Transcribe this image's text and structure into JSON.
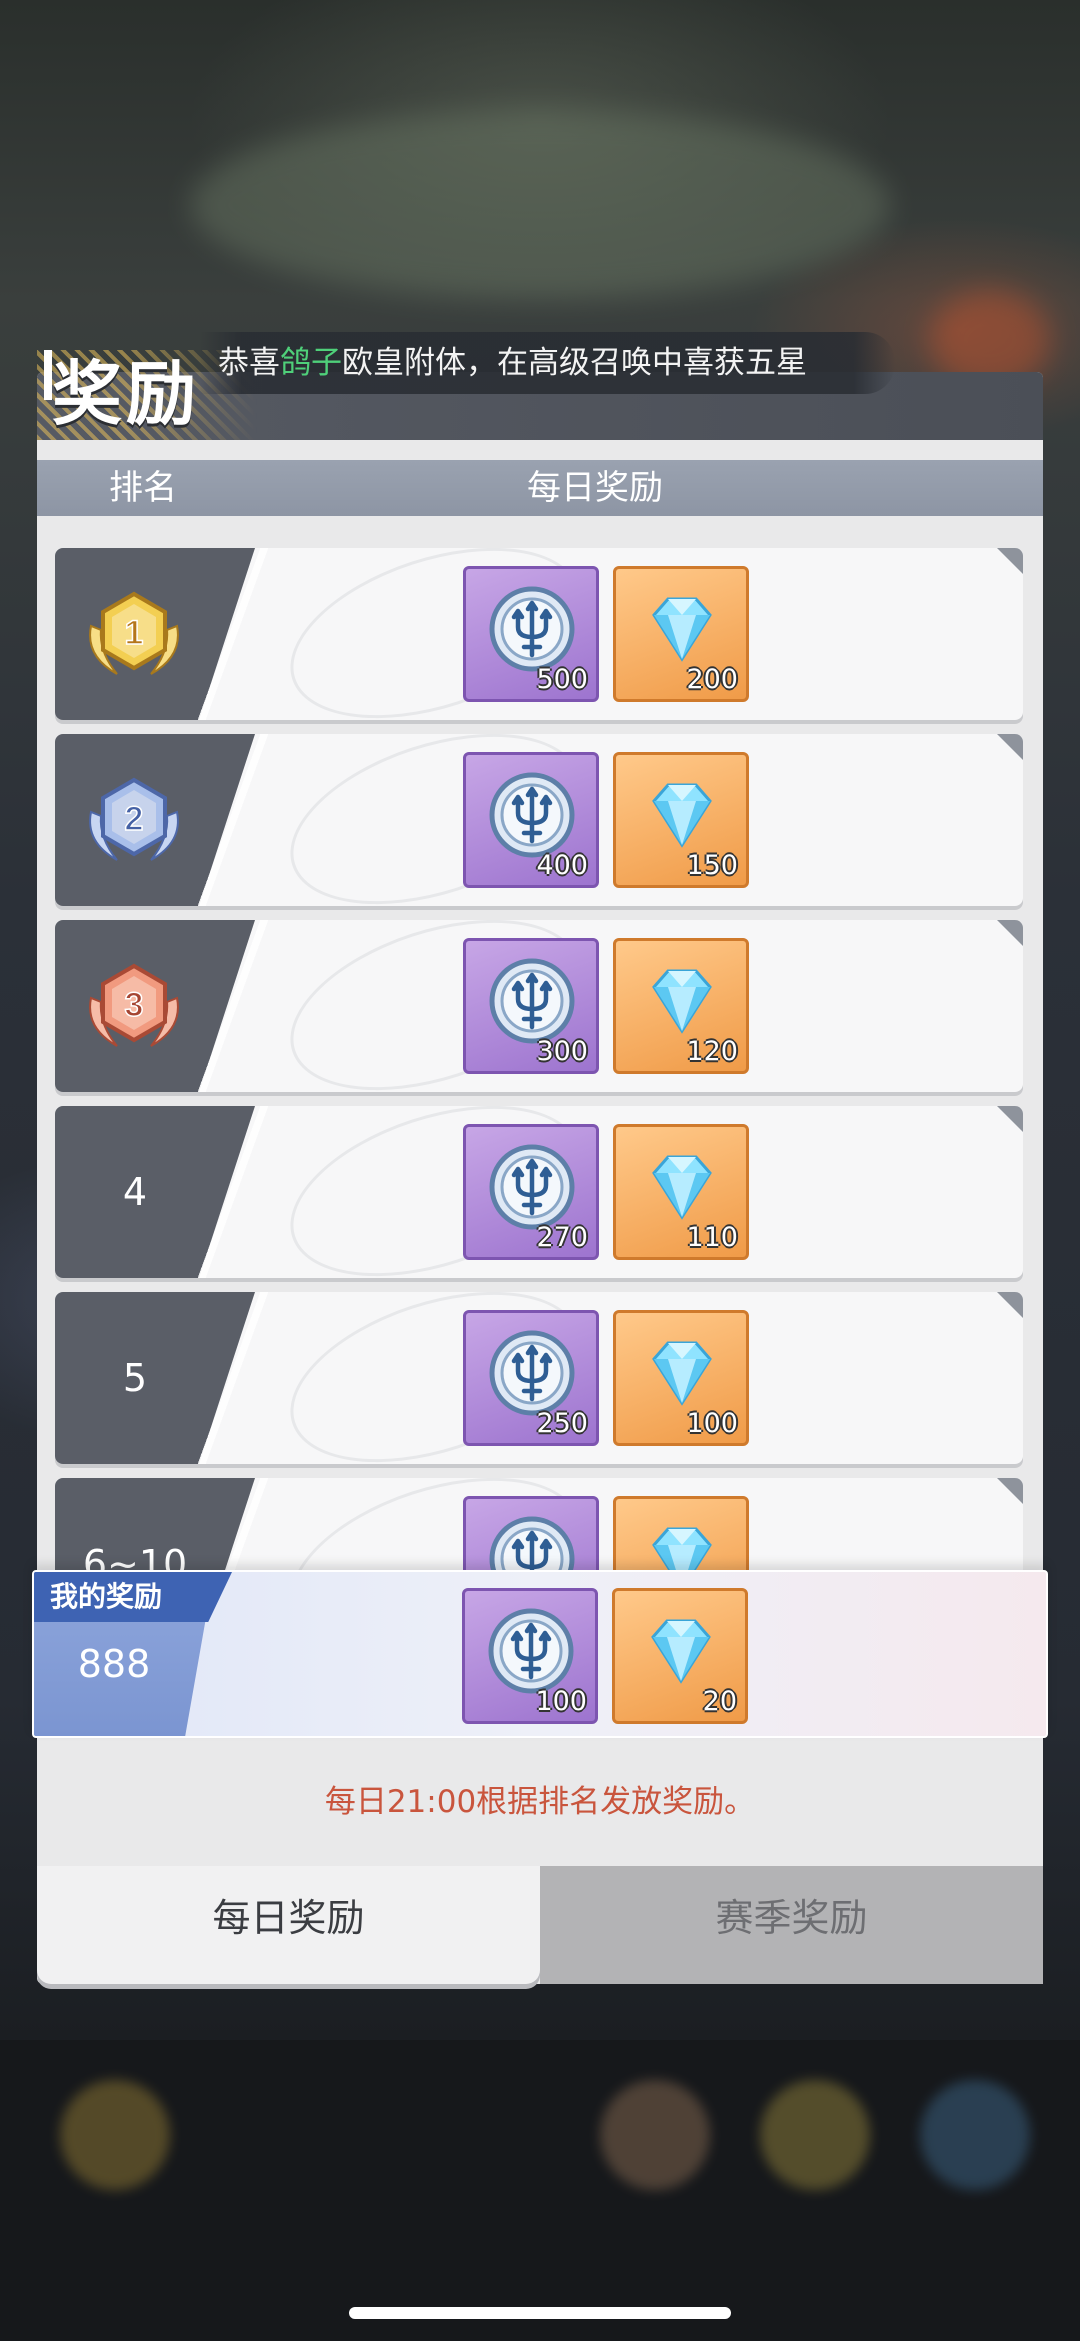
{
  "marquee": {
    "prefix": "恭喜",
    "name": "鸽子",
    "suffix": "欧皇附体，在高级召唤中喜获五星",
    "highlight_color": "#4fd07a"
  },
  "panel": {
    "title": "奖励",
    "columns": {
      "rank": "排名",
      "reward": "每日奖励"
    }
  },
  "rows": [
    {
      "rank": "1",
      "rank_style": "gold-medal",
      "tridents": "500",
      "diamonds": "200"
    },
    {
      "rank": "2",
      "rank_style": "silver-medal",
      "tridents": "400",
      "diamonds": "150"
    },
    {
      "rank": "3",
      "rank_style": "bronze-medal",
      "tridents": "300",
      "diamonds": "120"
    },
    {
      "rank": "4",
      "rank_style": "text",
      "tridents": "270",
      "diamonds": "110"
    },
    {
      "rank": "5",
      "rank_style": "text",
      "tridents": "250",
      "diamonds": "100"
    },
    {
      "rank": "6~10",
      "rank_style": "text",
      "tridents": "",
      "diamonds": ""
    }
  ],
  "my_reward": {
    "tag": "我的奖励",
    "rank": "888",
    "tridents": "100",
    "diamonds": "20"
  },
  "notice": "每日21:00根据排名发放奖励。",
  "tabs": [
    {
      "label": "每日奖励",
      "active": true
    },
    {
      "label": "赛季奖励",
      "active": false
    }
  ],
  "icons": {
    "trident": "trident-token-icon",
    "diamond": "diamond-icon"
  }
}
